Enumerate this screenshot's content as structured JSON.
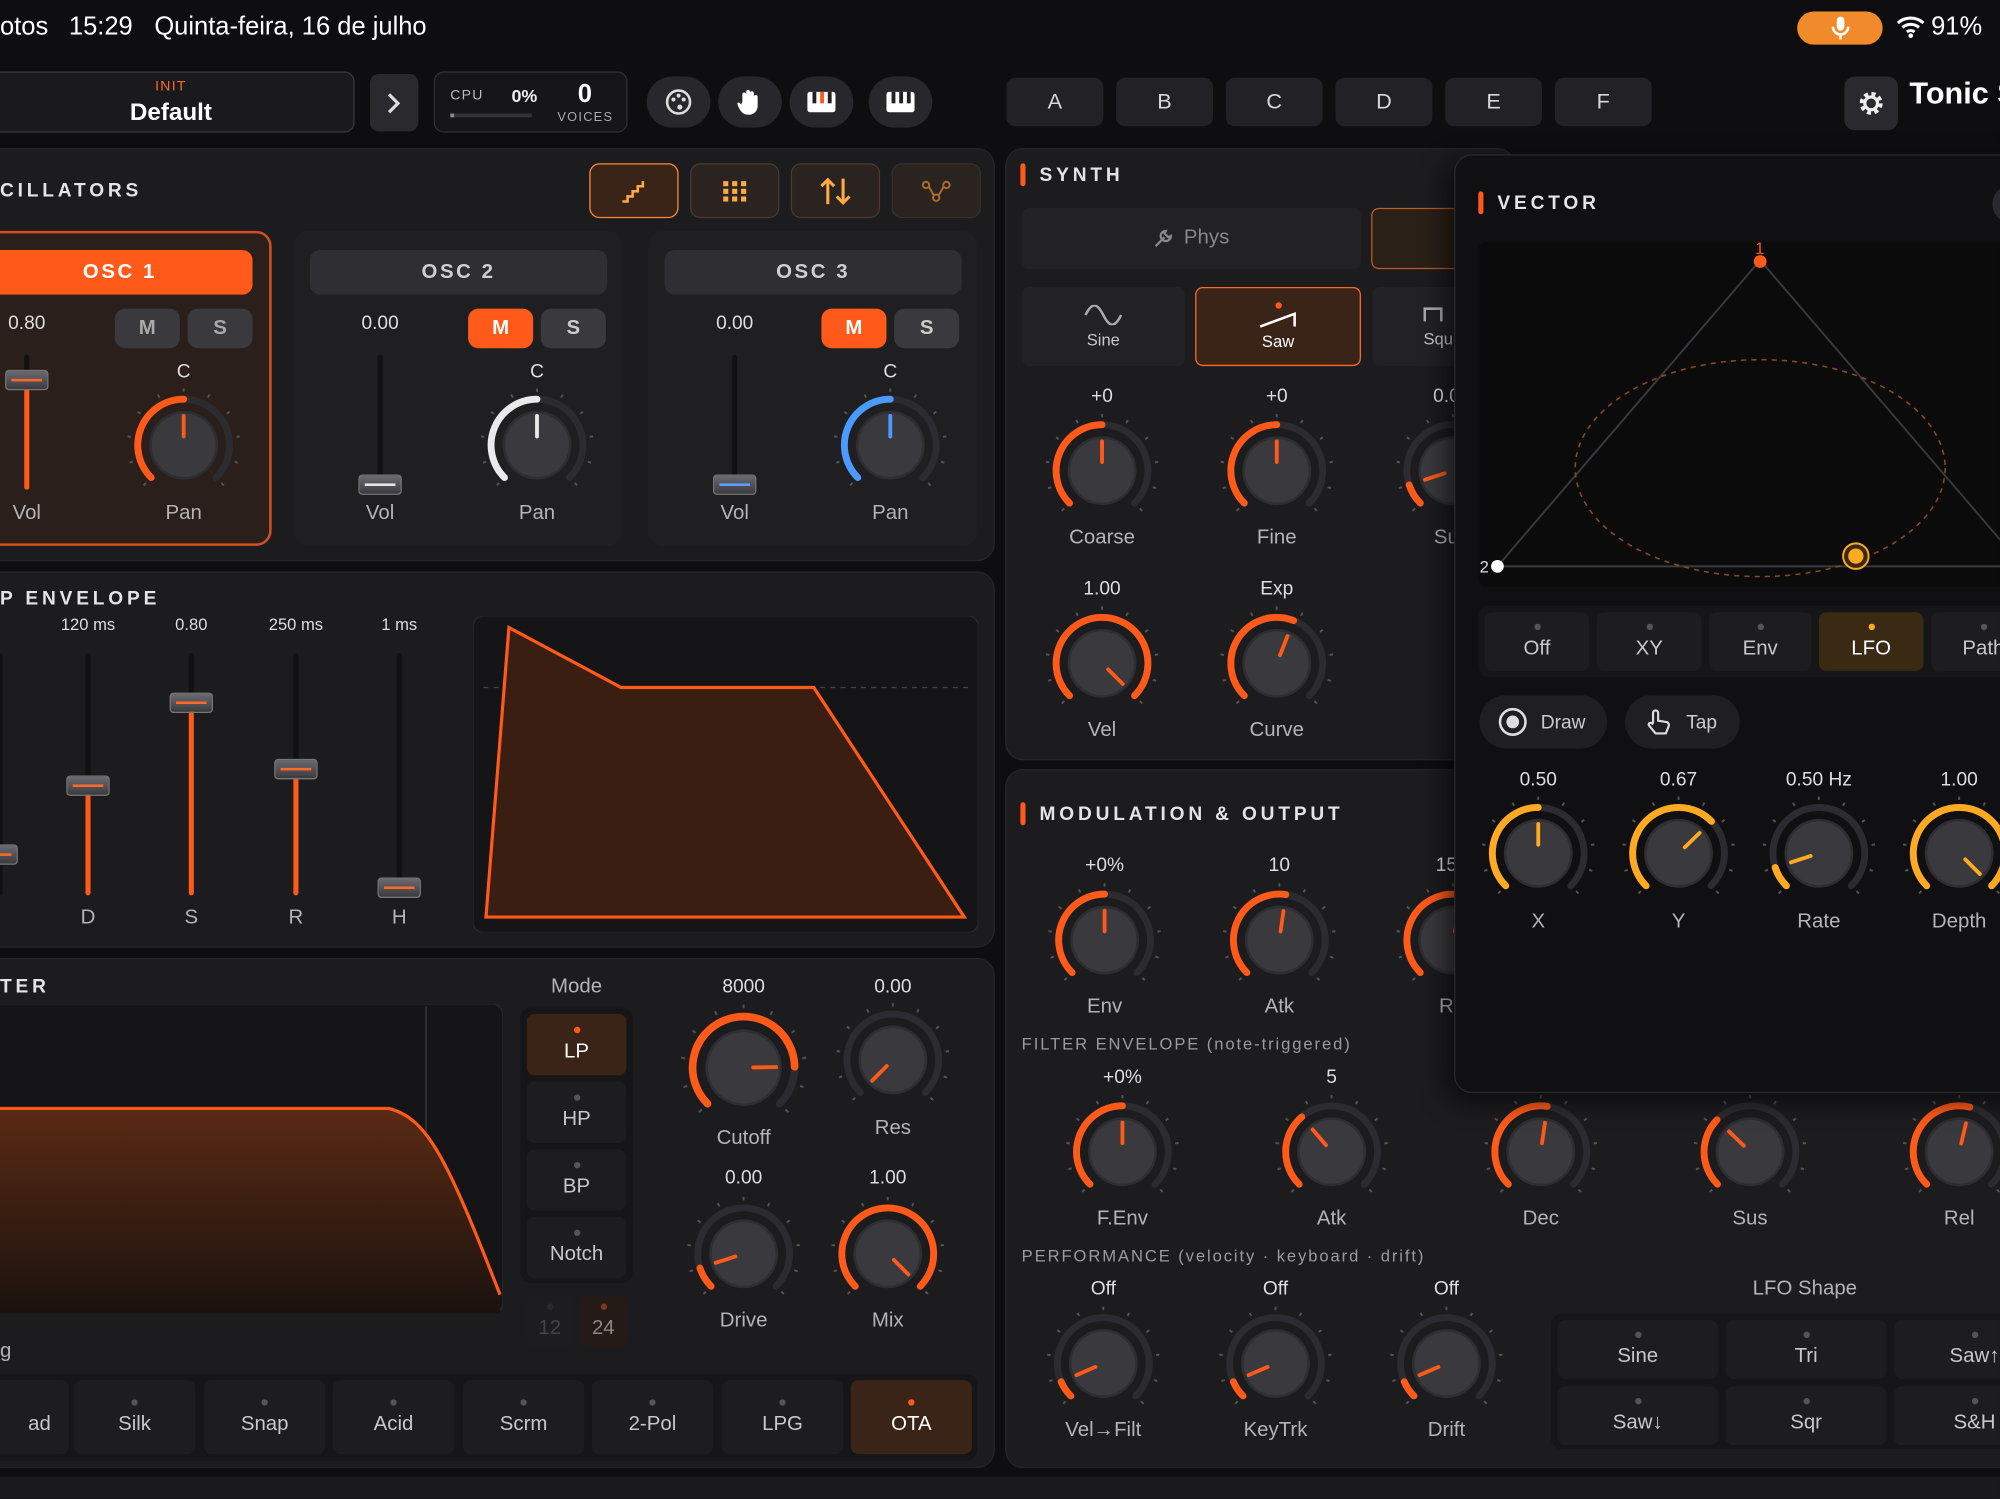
{
  "status": {
    "app_fragment": "otos",
    "time": "15:29",
    "date": "Quinta-feira, 16 de julho",
    "battery": "91%"
  },
  "preset": {
    "tag": "INIT",
    "name": "Default"
  },
  "cpu": {
    "label": "CPU",
    "value": "0%",
    "voices": "0",
    "voices_label": "VOICES"
  },
  "banks": [
    "A",
    "B",
    "C",
    "D",
    "E",
    "F"
  ],
  "app_title": "Tonic S",
  "osc": {
    "title": "CILLATORS",
    "mute": "M",
    "solo": "S",
    "vol_label": "Vol",
    "pan_label": "Pan",
    "pan_c": "C",
    "items": [
      {
        "name": "OSC 1",
        "vol": "0.80"
      },
      {
        "name": "OSC 2",
        "vol": "0.00"
      },
      {
        "name": "OSC 3",
        "vol": "0.00"
      }
    ]
  },
  "env": {
    "title": "P ENVELOPE",
    "vals": [
      "120 ms",
      "0.80",
      "250 ms",
      "1 ms"
    ],
    "labels": [
      "D",
      "S",
      "R",
      "H"
    ]
  },
  "filter": {
    "title": "TER",
    "mode_label": "Mode",
    "modes": [
      "LP",
      "HP",
      "BP",
      "Notch"
    ],
    "slopes": [
      "12",
      "24"
    ],
    "cutoff": "8000",
    "cutoff_label": "Cutoff",
    "res": "0.00",
    "res_label": "Res",
    "drive": "0.00",
    "drive_label": "Drive",
    "mix": "1.00",
    "mix_label": "Mix",
    "tail": "g",
    "types": [
      "ad",
      "Silk",
      "Snap",
      "Acid",
      "Scrm",
      "2-Pol",
      "LPG",
      "OTA"
    ]
  },
  "synth": {
    "title": "SYNTH",
    "engine": "Phys",
    "waves": [
      "Sine",
      "Saw",
      "Squ"
    ],
    "coarse": "+0",
    "coarse_label": "Coarse",
    "fine": "+0",
    "fine_label": "Fine",
    "sub": "0.0",
    "sub_label": "Su",
    "vel": "1.00",
    "vel_label": "Vel",
    "curve": "Exp",
    "curve_label": "Curve"
  },
  "mod": {
    "title": "MODULATION & OUTPUT",
    "env": "+0%",
    "env_label": "Env",
    "atk": "10",
    "atk_label": "Atk",
    "r_val": "15",
    "r_label": "R",
    "fenv_title": "FILTER ENVELOPE (note-triggered)",
    "fenv": "+0%",
    "fenv_label": "F.Env",
    "fatk": "5",
    "fatk_label": "Atk",
    "dec_label": "Dec",
    "sus_label": "Sus",
    "rel_label": "Rel",
    "perf_title": "PERFORMANCE (velocity · keyboard · drift)",
    "velf": "Off",
    "velf_label": "Vel→Filt",
    "keytrk": "Off",
    "keytrk_label": "KeyTrk",
    "drift": "Off",
    "drift_label": "Drift",
    "lfo_shape_title": "LFO Shape",
    "lfo_shapes": [
      "Sine",
      "Tri",
      "Saw↑",
      "Saw↓",
      "Sqr",
      "S&H"
    ]
  },
  "vector": {
    "title": "VECTOR",
    "corner_top": "1",
    "corner_left": "2",
    "modes": [
      "Off",
      "XY",
      "Env",
      "LFO",
      "Path"
    ],
    "draw": "Draw",
    "tap": "Tap",
    "x": "0.50",
    "x_label": "X",
    "y": "0.67",
    "y_label": "Y",
    "rate": "0.50 Hz",
    "rate_label": "Rate",
    "depth": "1.00",
    "depth_label": "Depth"
  },
  "colors": {
    "accent": "#ff5a1a",
    "lfo": "#ffaa22",
    "osc3": "#4a9aff"
  }
}
